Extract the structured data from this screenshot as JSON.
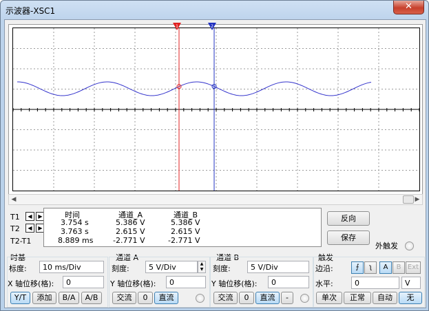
{
  "window": {
    "title": "示波器-XSC1",
    "close_glyph": "✕"
  },
  "display": {
    "bg": "#ffffff",
    "grid": "#9a9a9a",
    "axis": "#000000",
    "trace_color": "#3333cc",
    "cursor1_color": "#e02020",
    "cursor2_color": "#2030c0",
    "cursor1_label": "1",
    "cursor2_label": "2"
  },
  "readout": {
    "headers": {
      "time": "时间",
      "ch_a": "通道_A",
      "ch_b": "通道_B"
    },
    "rows": [
      {
        "label": "T1",
        "time": "3.754 s",
        "ch_a": "5.386 V",
        "ch_b": "5.386 V"
      },
      {
        "label": "T2",
        "time": "3.763 s",
        "ch_a": "2.615 V",
        "ch_b": "2.615 V"
      },
      {
        "label": "T2-T1",
        "time": "8.889 ms",
        "ch_a": "-2.771 V",
        "ch_b": "-2.771 V"
      }
    ]
  },
  "side_buttons": {
    "reverse": "反向",
    "save": "保存",
    "ext_trigger": "外触发"
  },
  "timebase": {
    "title": "时基",
    "scale_label": "标度:",
    "scale_value": "10 ms/Div",
    "xpos_label": "X 轴位移(格):",
    "xpos_value": "0",
    "buttons": [
      "Y/T",
      "添加",
      "B/A",
      "A/B"
    ]
  },
  "channel_a": {
    "title": "通道 A",
    "scale_label": "刻度:",
    "scale_value": "5  V/Div",
    "ypos_label": "Y 轴位移(格):",
    "ypos_value": "0",
    "buttons": [
      "交流",
      "0",
      "直流"
    ]
  },
  "channel_b": {
    "title": "通道 B",
    "scale_label": "刻度:",
    "scale_value": "5  V/Div",
    "ypos_label": "Y 轴位移(格):",
    "ypos_value": "0",
    "buttons": [
      "交流",
      "0",
      "直流",
      "-"
    ]
  },
  "trigger": {
    "title": "触发",
    "edge_label": "边沿:",
    "level_label": "水平:",
    "level_value": "0",
    "level_unit": "V",
    "edge_buttons": [
      "A",
      "B",
      "Ext"
    ],
    "mode_buttons": [
      "单次",
      "正常",
      "自动",
      "无"
    ]
  }
}
